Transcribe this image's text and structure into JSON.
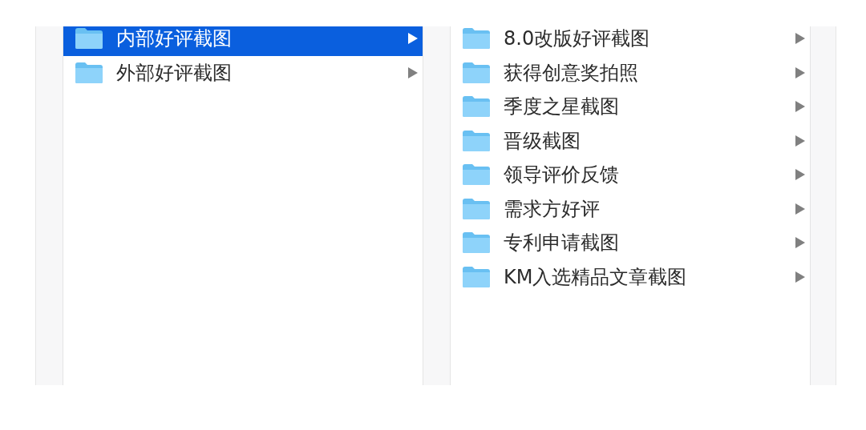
{
  "columns": [
    {
      "items": [
        {
          "label": "内部好评截图",
          "selected": true
        },
        {
          "label": "外部好评截图",
          "selected": false
        }
      ]
    },
    {
      "items": [
        {
          "label": "8.0改版好评截图",
          "selected": false
        },
        {
          "label": "获得创意奖拍照",
          "selected": false
        },
        {
          "label": "季度之星截图",
          "selected": false
        },
        {
          "label": "晋级截图",
          "selected": false
        },
        {
          "label": "领导评价反馈",
          "selected": false
        },
        {
          "label": "需求方好评",
          "selected": false
        },
        {
          "label": "专利申请截图",
          "selected": false
        },
        {
          "label": "KM入选精品文章截图",
          "selected": false
        }
      ]
    }
  ]
}
